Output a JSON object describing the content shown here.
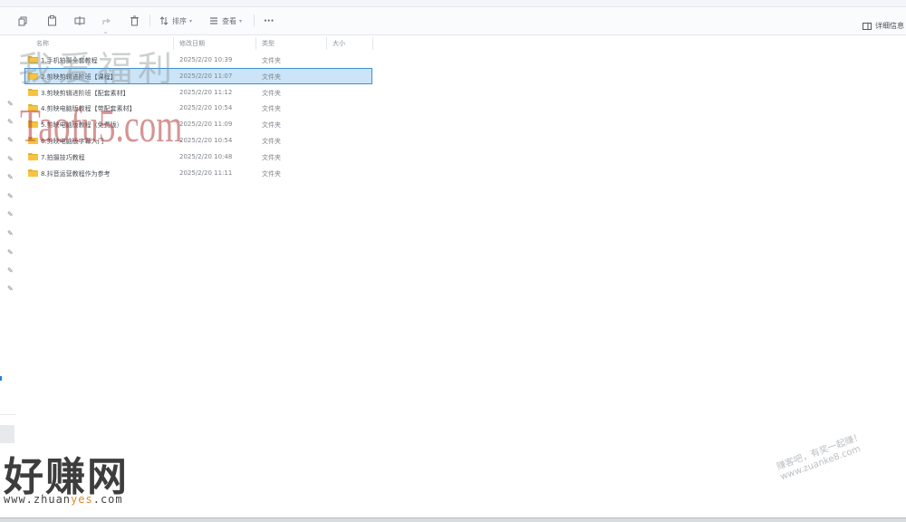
{
  "toolbar": {
    "sort_label": "排序",
    "view_label": "查看",
    "more_label": "···",
    "details_label": "详细信息"
  },
  "columns": {
    "name": "名称",
    "date": "修改日期",
    "type": "类型",
    "size": "大小"
  },
  "rows": [
    {
      "name": "1.手机拍摄全套教程",
      "date": "2025/2/20 10:39",
      "type": "文件夹",
      "selected": false
    },
    {
      "name": "2.剪映剪辑进阶班【课程】",
      "date": "2025/2/20 11:07",
      "type": "文件夹",
      "selected": true
    },
    {
      "name": "3.剪映剪辑进阶班【配套素材】",
      "date": "2025/2/20 11:12",
      "type": "文件夹",
      "selected": false
    },
    {
      "name": "4.剪映电脑版教程【带配套素材】",
      "date": "2025/2/20 10:54",
      "type": "文件夹",
      "selected": false
    },
    {
      "name": "5.剪映电脑版教程（免费版）",
      "date": "2025/2/20 11:09",
      "type": "文件夹",
      "selected": false
    },
    {
      "name": "6.剪映电脑版字幕入门",
      "date": "2025/2/20 10:54",
      "type": "文件夹",
      "selected": false
    },
    {
      "name": "7.拍摄技巧教程",
      "date": "2025/2/20 10:48",
      "type": "文件夹",
      "selected": false
    },
    {
      "name": "8.抖音运营教程作为参考",
      "date": "2025/2/20 11:11",
      "type": "文件夹",
      "selected": false
    }
  ],
  "watermarks": {
    "cn_top": "我爱福利",
    "latin": "Taofu5.com",
    "brand": "好赚网",
    "url_prefix": "www.zhuan",
    "url_highlight": "yes",
    "url_suffix": ".com",
    "corner_line1": "赚客吧，有奖一起赚！",
    "corner_line2": "www.zuanke8.com"
  },
  "colors": {
    "selection_bg": "#cce4f7",
    "selection_border": "#3e8fd6",
    "folder": "#f5c542",
    "folder_tab": "#e6ad24"
  }
}
